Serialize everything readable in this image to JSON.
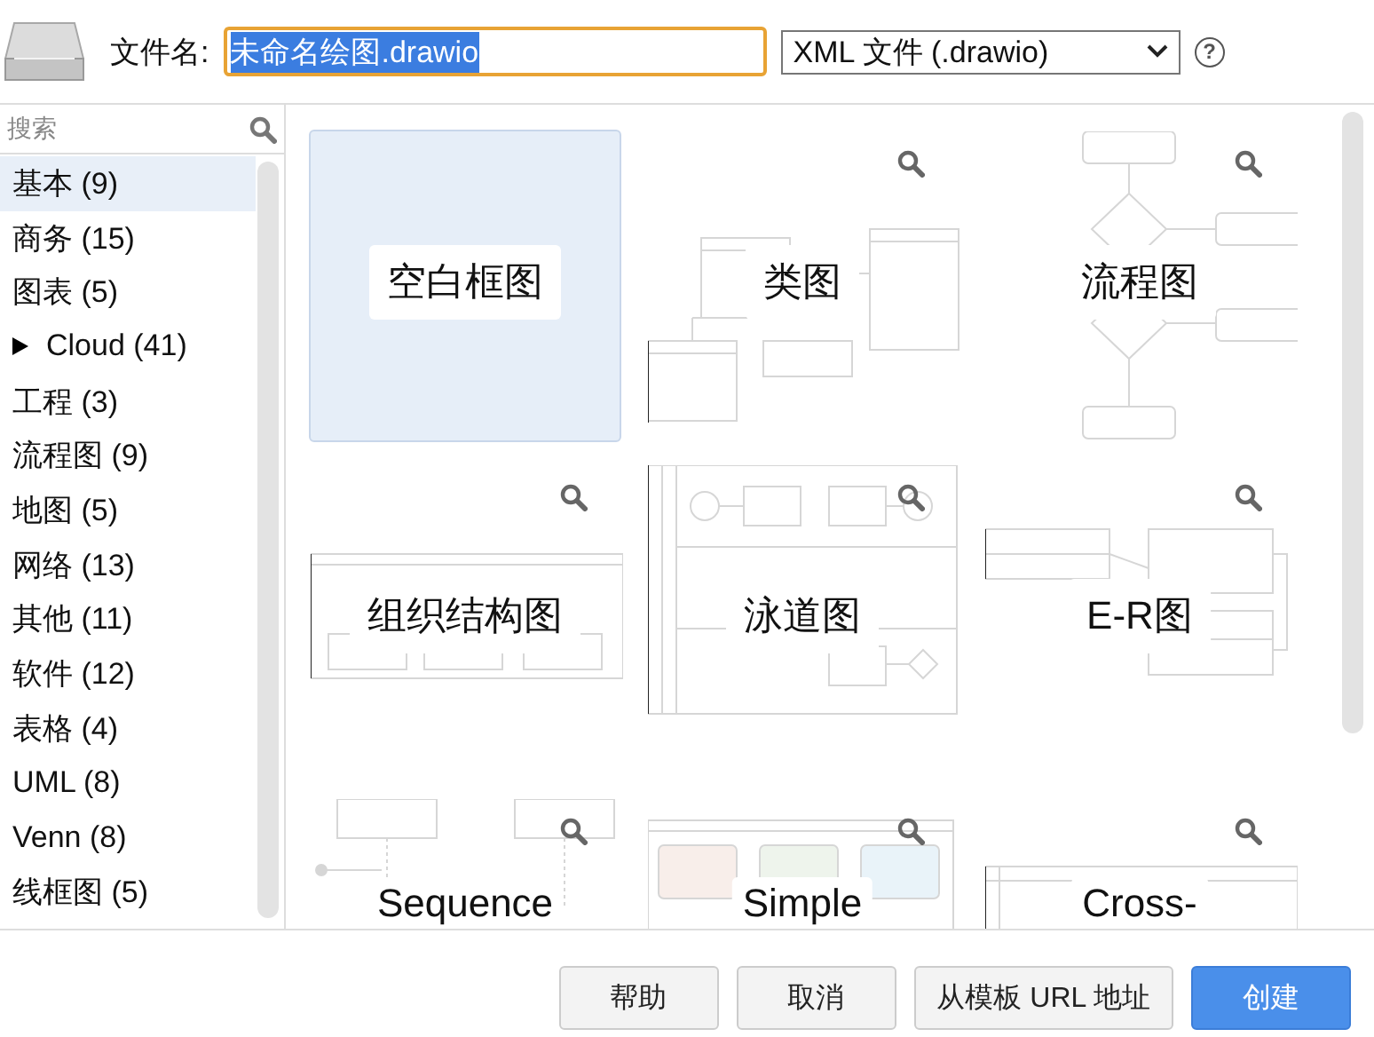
{
  "header": {
    "filename_label": "文件名:",
    "filename_value": "未命名绘图.drawio",
    "format": "XML 文件 (.drawio)",
    "help": "?"
  },
  "sidebar": {
    "search_placeholder": "搜索",
    "items": [
      {
        "label": "基本 (9)",
        "kind": "category",
        "selected": true
      },
      {
        "label": "商务 (15)",
        "kind": "category",
        "selected": false
      },
      {
        "label": "图表 (5)",
        "kind": "category",
        "selected": false
      },
      {
        "label": "Cloud (41)",
        "kind": "group",
        "expanded": false,
        "selected": false
      },
      {
        "label": "工程 (3)",
        "kind": "category",
        "selected": false
      },
      {
        "label": "流程图 (9)",
        "kind": "category",
        "selected": false
      },
      {
        "label": "地图 (5)",
        "kind": "category",
        "selected": false
      },
      {
        "label": "网络 (13)",
        "kind": "category",
        "selected": false
      },
      {
        "label": "其他 (11)",
        "kind": "category",
        "selected": false
      },
      {
        "label": "软件 (12)",
        "kind": "category",
        "selected": false
      },
      {
        "label": "表格 (4)",
        "kind": "category",
        "selected": false
      },
      {
        "label": "UML (8)",
        "kind": "category",
        "selected": false
      },
      {
        "label": "Venn (8)",
        "kind": "category",
        "selected": false
      },
      {
        "label": "线框图 (5)",
        "kind": "category",
        "selected": false
      }
    ]
  },
  "templates": [
    {
      "label": "空白框图",
      "kind": "blank",
      "selected": true
    },
    {
      "label": "类图",
      "kind": "class",
      "selected": false
    },
    {
      "label": "流程图",
      "kind": "flowchart",
      "selected": false
    },
    {
      "label": "组织结构图",
      "kind": "org",
      "selected": false
    },
    {
      "label": "泳道图",
      "kind": "swimlane",
      "selected": false
    },
    {
      "label": "E-R图",
      "kind": "er",
      "selected": false
    },
    {
      "label": "Sequence",
      "kind": "sequence",
      "selected": false
    },
    {
      "label": "Simple",
      "kind": "simple",
      "selected": false
    },
    {
      "label": "Cross-",
      "kind": "cross",
      "selected": false
    }
  ],
  "buttons": [
    {
      "label": "帮助",
      "kind": "normal"
    },
    {
      "label": "取消",
      "kind": "normal"
    },
    {
      "label": "从模板 URL 地址",
      "kind": "normal"
    },
    {
      "label": "创建",
      "kind": "primary"
    }
  ]
}
